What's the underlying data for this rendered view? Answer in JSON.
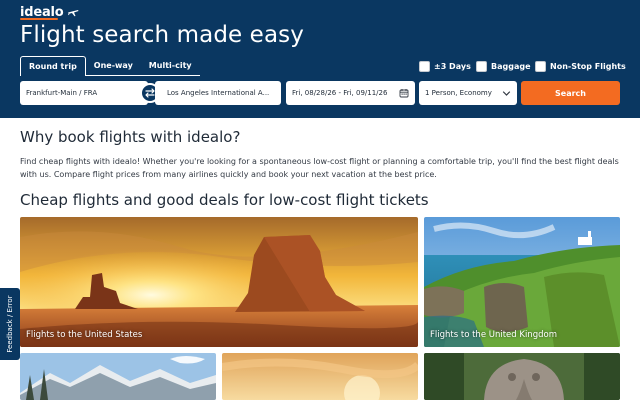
{
  "brand": {
    "logo_text": "idealo",
    "accent": "#f36b21",
    "header_bg": "#0a3761"
  },
  "hero": {
    "title": "Flight search made easy"
  },
  "tabs": [
    {
      "label": "Round trip",
      "active": true
    },
    {
      "label": "One-way",
      "active": false
    },
    {
      "label": "Multi-city",
      "active": false
    }
  ],
  "options": {
    "days": {
      "label": "±3 Days",
      "checked": false
    },
    "baggage": {
      "label": "Baggage",
      "checked": false
    },
    "nonstop": {
      "label": "Non-Stop Flights",
      "checked": false
    }
  },
  "search": {
    "origin": "Frankfurt-Main / FRA",
    "destination": "Los Angeles International A...",
    "dates": "Fri, 08/28/26 - Fri, 09/11/26",
    "passengers": "1 Person, Economy",
    "button_label": "Search"
  },
  "why": {
    "title": "Why book flights with idealo?",
    "text": "Find cheap flights with idealo! Whether you're looking for a spontaneous low-cost flight or planning a comfortable trip, you'll find the best flight deals with us. Compare flight prices from many airlines quickly and book your next vacation at the best price."
  },
  "deals": {
    "title": "Cheap flights and good deals for low-cost flight tickets",
    "cards": [
      {
        "label": "Flights to the United States"
      },
      {
        "label": "Flights to the United Kingdom"
      }
    ]
  },
  "feedback": {
    "label": "Feedback / Error"
  }
}
